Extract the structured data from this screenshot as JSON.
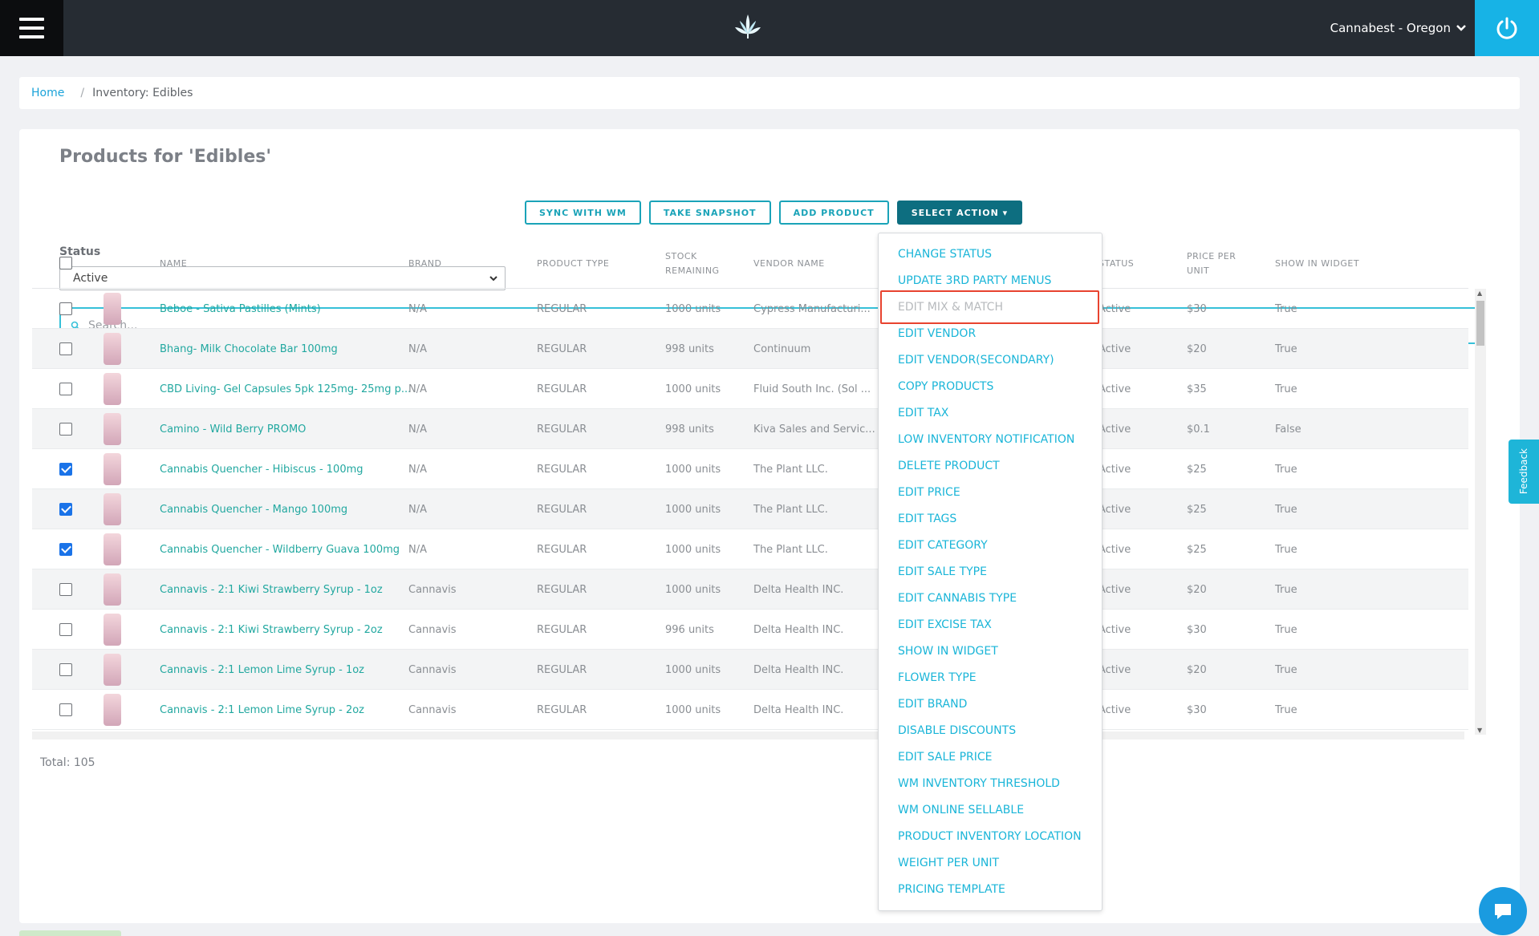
{
  "header": {
    "store_name": "Cannabest - Oregon",
    "icons": {
      "menu": "hamburger-icon",
      "logo": "cannabis-leaf-icon",
      "power": "power-icon",
      "dropdown": "chevron-down-icon"
    }
  },
  "breadcrumb": {
    "home": "Home",
    "separator": "/",
    "current": "Inventory: Edibles"
  },
  "page": {
    "title": "Products for 'Edibles'",
    "total": "Total: 105"
  },
  "buttons": {
    "sync": "SYNC WITH WM",
    "snapshot": "TAKE SNAPSHOT",
    "add": "ADD PRODUCT",
    "select_action": "SELECT ACTION ▾"
  },
  "status_filter": {
    "label": "Status",
    "value": "Active"
  },
  "search": {
    "placeholder": "Search..."
  },
  "table": {
    "headers": {
      "name": "NAME",
      "brand": "BRAND",
      "product_type": "PRODUCT TYPE",
      "stock_1": "STOCK",
      "stock_2": "REMAINING",
      "vendor": "VENDOR NAME",
      "status": "STATUS",
      "price_1": "PRICE PER",
      "price_2": "UNIT",
      "widget": "SHOW IN WIDGET"
    },
    "rows": [
      {
        "checked": false,
        "name": "Beboe - Sativa Pastilles (Mints)",
        "brand": "N/A",
        "type": "REGULAR",
        "stock": "1000 units",
        "vendor": "Cypress Manufacturi...",
        "status": "Active",
        "price": "$30",
        "widget": "True"
      },
      {
        "checked": false,
        "name": "Bhang- Milk Chocolate Bar 100mg",
        "brand": "N/A",
        "type": "REGULAR",
        "stock": "998 units",
        "vendor": "Continuum",
        "status": "Active",
        "price": "$20",
        "widget": "True"
      },
      {
        "checked": false,
        "name": "CBD Living- Gel Capsules 5pk 125mg- 25mg p...",
        "brand": "N/A",
        "type": "REGULAR",
        "stock": "1000 units",
        "vendor": "Fluid South Inc. (Sol ...",
        "status": "Active",
        "price": "$35",
        "widget": "True"
      },
      {
        "checked": false,
        "name": "Camino - Wild Berry PROMO",
        "brand": "N/A",
        "type": "REGULAR",
        "stock": "998 units",
        "vendor": "Kiva Sales and Servic...",
        "status": "Active",
        "price": "$0.1",
        "widget": "False"
      },
      {
        "checked": true,
        "name": "Cannabis Quencher - Hibiscus - 100mg",
        "brand": "N/A",
        "type": "REGULAR",
        "stock": "1000 units",
        "vendor": "The Plant LLC.",
        "status": "Active",
        "price": "$25",
        "widget": "True"
      },
      {
        "checked": true,
        "name": "Cannabis Quencher - Mango 100mg",
        "brand": "N/A",
        "type": "REGULAR",
        "stock": "1000 units",
        "vendor": "The Plant LLC.",
        "status": "Active",
        "price": "$25",
        "widget": "True"
      },
      {
        "checked": true,
        "name": "Cannabis Quencher - Wildberry Guava 100mg",
        "brand": "N/A",
        "type": "REGULAR",
        "stock": "1000 units",
        "vendor": "The Plant LLC.",
        "status": "Active",
        "price": "$25",
        "widget": "True"
      },
      {
        "checked": false,
        "name": "Cannavis - 2:1 Kiwi Strawberry Syrup - 1oz",
        "brand": "Cannavis",
        "type": "REGULAR",
        "stock": "1000 units",
        "vendor": "Delta Health INC.",
        "status": "Active",
        "price": "$20",
        "widget": "True"
      },
      {
        "checked": false,
        "name": "Cannavis - 2:1 Kiwi Strawberry Syrup - 2oz",
        "brand": "Cannavis",
        "type": "REGULAR",
        "stock": "996 units",
        "vendor": "Delta Health INC.",
        "status": "Active",
        "price": "$30",
        "widget": "True"
      },
      {
        "checked": false,
        "name": "Cannavis - 2:1 Lemon Lime Syrup - 1oz",
        "brand": "Cannavis",
        "type": "REGULAR",
        "stock": "1000 units",
        "vendor": "Delta Health INC.",
        "status": "Active",
        "price": "$20",
        "widget": "True"
      },
      {
        "checked": false,
        "name": "Cannavis - 2:1 Lemon Lime Syrup - 2oz",
        "brand": "Cannavis",
        "type": "REGULAR",
        "stock": "1000 units",
        "vendor": "Delta Health INC.",
        "status": "Active",
        "price": "$30",
        "widget": "True"
      }
    ]
  },
  "dropdown": {
    "items": [
      {
        "label": "CHANGE STATUS",
        "disabled": false
      },
      {
        "label": "UPDATE 3RD PARTY MENUS",
        "disabled": false
      },
      {
        "label": "EDIT MIX & MATCH",
        "disabled": true
      },
      {
        "label": "EDIT VENDOR",
        "disabled": false
      },
      {
        "label": "EDIT VENDOR(SECONDARY)",
        "disabled": false
      },
      {
        "label": "COPY PRODUCTS",
        "disabled": false
      },
      {
        "label": "EDIT TAX",
        "disabled": false
      },
      {
        "label": "LOW INVENTORY NOTIFICATION",
        "disabled": false
      },
      {
        "label": "DELETE PRODUCT",
        "disabled": false
      },
      {
        "label": "EDIT PRICE",
        "disabled": false
      },
      {
        "label": "EDIT TAGS",
        "disabled": false
      },
      {
        "label": "EDIT CATEGORY",
        "disabled": false
      },
      {
        "label": "EDIT SALE TYPE",
        "disabled": false
      },
      {
        "label": "EDIT CANNABIS TYPE",
        "disabled": false
      },
      {
        "label": "EDIT EXCISE TAX",
        "disabled": false
      },
      {
        "label": "SHOW IN WIDGET",
        "disabled": false
      },
      {
        "label": "FLOWER TYPE",
        "disabled": false
      },
      {
        "label": "EDIT BRAND",
        "disabled": false
      },
      {
        "label": "DISABLE DISCOUNTS",
        "disabled": false
      },
      {
        "label": "EDIT SALE PRICE",
        "disabled": false
      },
      {
        "label": "WM INVENTORY THRESHOLD",
        "disabled": false
      },
      {
        "label": "WM ONLINE SELLABLE",
        "disabled": false
      },
      {
        "label": "PRODUCT INVENTORY LOCATION",
        "disabled": false
      },
      {
        "label": "WEIGHT PER UNIT",
        "disabled": false
      },
      {
        "label": "PRICING TEMPLATE",
        "disabled": false
      }
    ]
  },
  "feedback": {
    "label": "Feedback"
  },
  "colors": {
    "accent": "#1ab5d8",
    "primary_button": "#0d6e80",
    "topbar": "#262c33",
    "highlight": "#e8432f"
  }
}
